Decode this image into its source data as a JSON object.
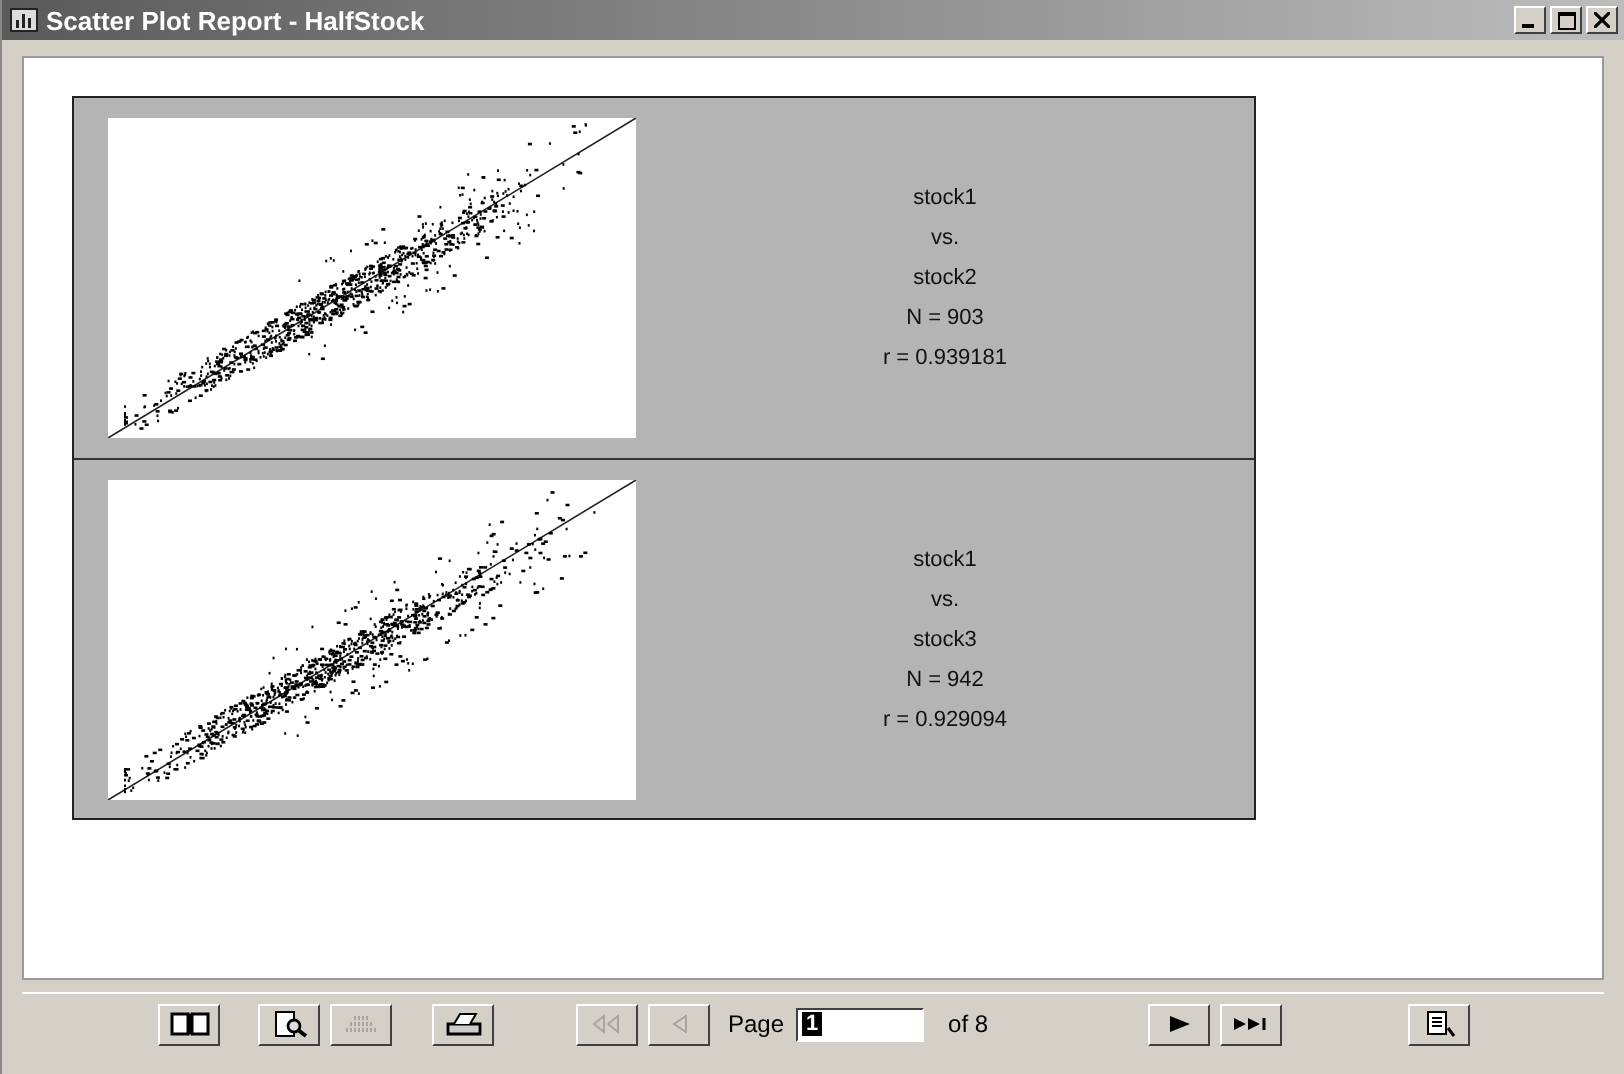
{
  "window": {
    "title": "Scatter Plot Report - HalfStock"
  },
  "report": {
    "rows": [
      {
        "labels": [
          "stock1",
          "vs.",
          "stock2",
          "N = 903",
          "r = 0.939181"
        ]
      },
      {
        "labels": [
          "stock1",
          "vs.",
          "stock3",
          "N = 942",
          "r = 0.929094"
        ]
      }
    ]
  },
  "toolbar": {
    "buttons": [
      {
        "kind": "book",
        "disabled": false
      },
      {
        "kind": "preview",
        "disabled": false
      },
      {
        "kind": "pages",
        "disabled": true
      },
      {
        "kind": "print",
        "disabled": false
      },
      {
        "kind": "first",
        "disabled": true
      },
      {
        "kind": "prev",
        "disabled": true
      },
      {
        "kind": "pager"
      },
      {
        "kind": "next",
        "disabled": false
      },
      {
        "kind": "last",
        "disabled": false
      },
      {
        "kind": "export",
        "disabled": false
      }
    ],
    "page_label": "Page",
    "page_value": "1",
    "page_total": "of 8"
  }
}
